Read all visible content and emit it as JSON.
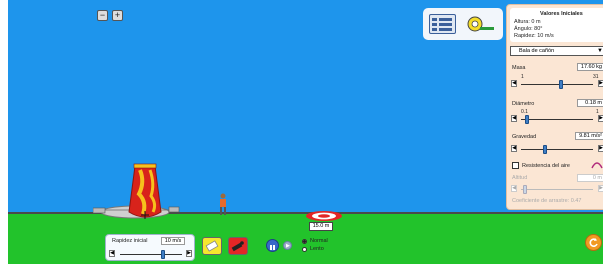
{
  "zoom": {
    "out_icon": "zoom-out-icon",
    "in_icon": "zoom-in-icon"
  },
  "tools": {
    "measure_icon": "measuring-tape-icon",
    "table_icon": "data-table-icon"
  },
  "initial": {
    "title": "Valores Iniciales",
    "height": "Altura: 0 m",
    "angle": "Ángulo: 80°",
    "speed": "Rapidez: 10 m/s"
  },
  "projectile": {
    "selected": "Bala de cañón"
  },
  "mass": {
    "label": "Masa",
    "value": "17.60 kg",
    "min": "1",
    "max": "31",
    "fraction": 0.55
  },
  "diameter": {
    "label": "Diámetro",
    "value": "0.18 m",
    "min": "0.1",
    "max": "1",
    "fraction": 0.09
  },
  "gravity": {
    "label": "Gravedad",
    "value": "9.81 m/s²",
    "fraction": 0.33
  },
  "air": {
    "label": "Resistencia del aire",
    "altitude_label": "Altitud",
    "altitude_value": "0 m",
    "drag_label": "Coeficiente de arrastre: 0.47"
  },
  "target": {
    "distance": "15.0 m"
  },
  "speed_control": {
    "label": "Rapidez inicial",
    "value": "10 m/s",
    "fraction": 0.7
  },
  "playback": {
    "normal": "Normal",
    "slow": "Lento",
    "selected": "normal"
  },
  "colors": {
    "sky": "#1e95ec",
    "ground": "#22c32b",
    "panel": "#fbe6d4",
    "cannon_red": "#d8231b",
    "cannon_yellow": "#f6c21c"
  }
}
